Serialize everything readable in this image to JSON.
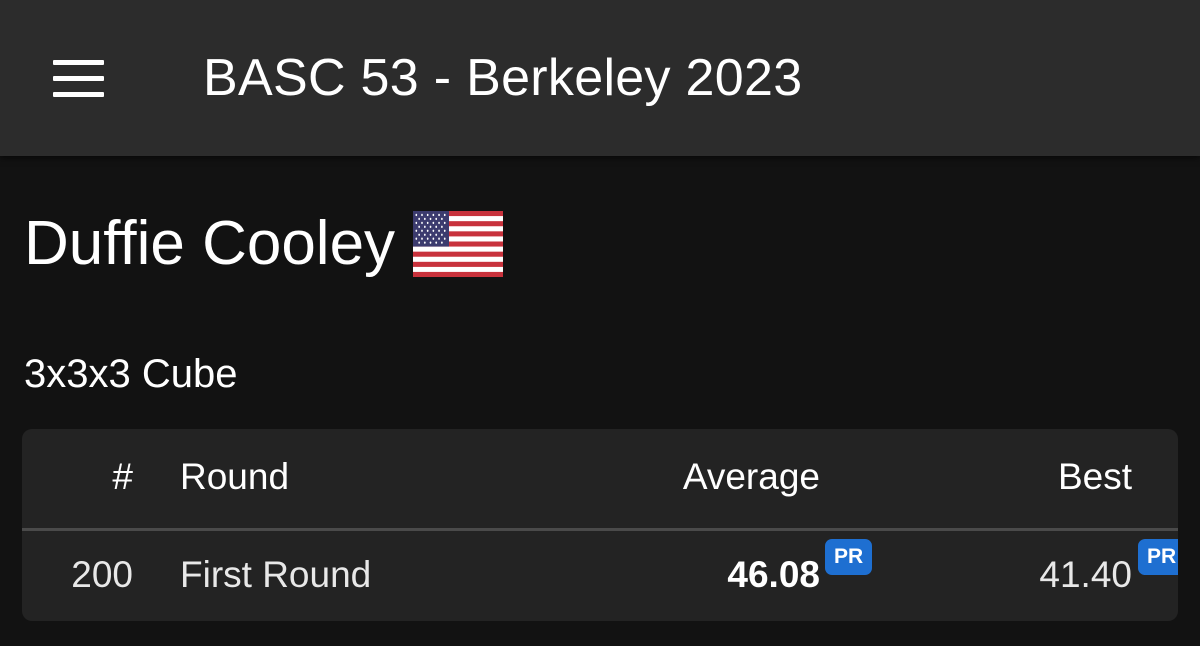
{
  "app_bar": {
    "title": "BASC 53 - Berkeley 2023",
    "menu_icon": "hamburger-menu-icon"
  },
  "person": {
    "name": "Duffie Cooley",
    "country_flag": "us-flag-icon"
  },
  "event": {
    "name": "3x3x3 Cube"
  },
  "results_table": {
    "headers": {
      "rank": "#",
      "round": "Round",
      "average": "Average",
      "best": "Best"
    },
    "rows": [
      {
        "rank": "200",
        "round": "First Round",
        "average": "46.08",
        "average_badge": "PR",
        "best": "41.40",
        "best_badge": "PR"
      }
    ]
  },
  "colors": {
    "background": "#121212",
    "app_bar": "#2c2c2c",
    "card": "#232323",
    "pr_badge": "#1e6fd1",
    "text": "#ffffff"
  }
}
